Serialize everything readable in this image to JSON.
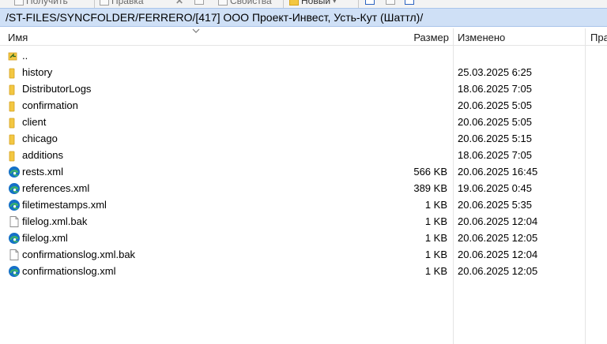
{
  "toolbar": {
    "get_label": "Получить",
    "edit_label": "Правка",
    "properties_label": "Свойства",
    "new_label": "Новый"
  },
  "path": "/ST-FILES/SYNCFOLDER/FERRERO/[417] ООО Проект-Инвест, Усть-Кут (Шаттл)/",
  "columns": {
    "name": "Имя",
    "size": "Размер",
    "modified": "Изменено",
    "rights": "Пра"
  },
  "files": [
    {
      "name": "..",
      "size": "",
      "modified": "",
      "icon": "parent-folder-icon"
    },
    {
      "name": "history",
      "size": "",
      "modified": "25.03.2025 6:25",
      "icon": "folder-icon"
    },
    {
      "name": "DistributorLogs",
      "size": "",
      "modified": "18.06.2025 7:05",
      "icon": "folder-icon"
    },
    {
      "name": "confirmation",
      "size": "",
      "modified": "20.06.2025 5:05",
      "icon": "folder-icon"
    },
    {
      "name": "client",
      "size": "",
      "modified": "20.06.2025 5:05",
      "icon": "folder-icon"
    },
    {
      "name": "chicago",
      "size": "",
      "modified": "20.06.2025 5:15",
      "icon": "folder-icon"
    },
    {
      "name": "additions",
      "size": "",
      "modified": "18.06.2025 7:05",
      "icon": "folder-icon"
    },
    {
      "name": "rests.xml",
      "size": "566 KB",
      "modified": "20.06.2025 16:45",
      "icon": "edge-icon"
    },
    {
      "name": "references.xml",
      "size": "389 KB",
      "modified": "19.06.2025 0:45",
      "icon": "edge-icon"
    },
    {
      "name": "filetimestamps.xml",
      "size": "1 KB",
      "modified": "20.06.2025 5:35",
      "icon": "edge-icon"
    },
    {
      "name": "filelog.xml.bak",
      "size": "1 KB",
      "modified": "20.06.2025 12:04",
      "icon": "file-icon"
    },
    {
      "name": "filelog.xml",
      "size": "1 KB",
      "modified": "20.06.2025 12:05",
      "icon": "edge-icon"
    },
    {
      "name": "confirmationslog.xml.bak",
      "size": "1 KB",
      "modified": "20.06.2025 12:04",
      "icon": "file-icon"
    },
    {
      "name": "confirmationslog.xml",
      "size": "1 KB",
      "modified": "20.06.2025 12:05",
      "icon": "edge-icon"
    }
  ],
  "colors": {
    "path_bar_bg": "#cfe0f6",
    "folder": "#f3c742",
    "edge_blue": "#1570c8",
    "edge_green": "#3bb36b"
  }
}
